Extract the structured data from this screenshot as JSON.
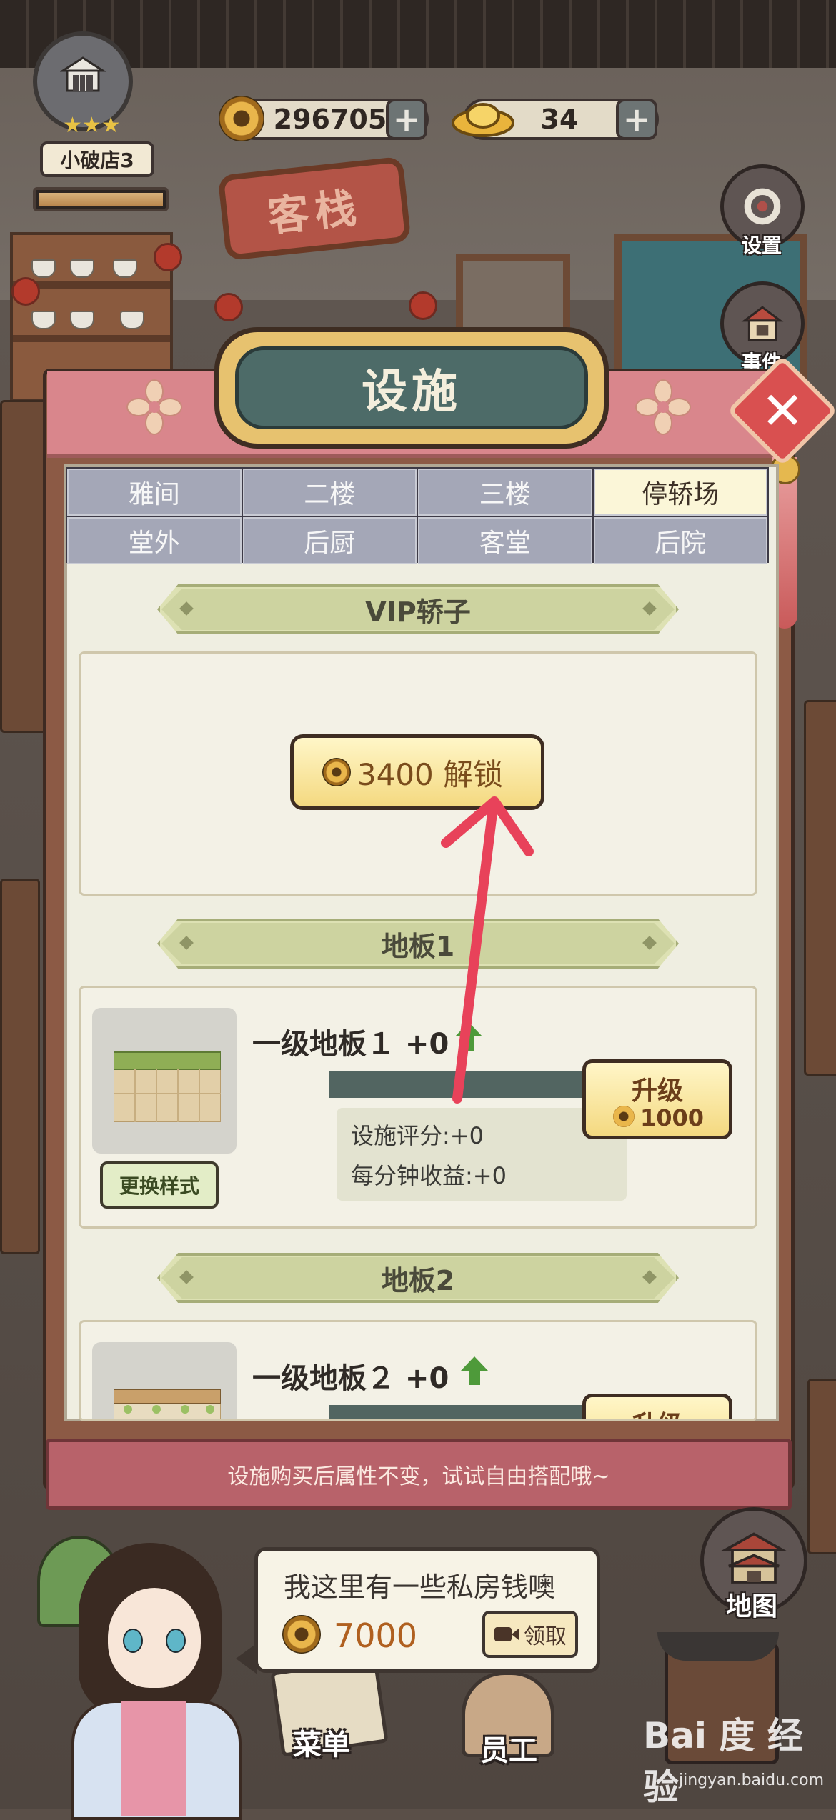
{
  "hud": {
    "shop_level_name": "小破店3",
    "coins": "296705",
    "ingots": "34",
    "plus": "+"
  },
  "side_buttons": {
    "settings": "设置",
    "events": "事件",
    "map": "地图"
  },
  "shop_sign": "客栈",
  "panel": {
    "title": "设施",
    "close": "✕",
    "tabs": [
      {
        "label": "雅间"
      },
      {
        "label": "二楼"
      },
      {
        "label": "三楼"
      },
      {
        "label": "停轿场",
        "active": true
      },
      {
        "label": "堂外"
      },
      {
        "label": "后厨"
      },
      {
        "label": "客堂"
      },
      {
        "label": "后院"
      }
    ],
    "sections": [
      {
        "title": "VIP轿子",
        "unlock_label": "3400 解锁"
      },
      {
        "title": "地板1",
        "item_name": "一级地板１ +0",
        "stat_rating": "设施评分:+0",
        "stat_income": "每分钟收益:+0",
        "upgrade_label": "升级",
        "upgrade_cost": "1000",
        "change_style_label": "更换样式"
      },
      {
        "title": "地板2",
        "item_name": "一级地板２ +0",
        "upgrade_label": "升级"
      }
    ],
    "footer_tip": "设施购买后属性不变，试试自由搭配哦~"
  },
  "bottom": {
    "speech_message": "我这里有一些私房钱噢",
    "speech_amount": "7000",
    "claim_label": "领取",
    "nav": [
      {
        "label": "菜单"
      },
      {
        "label": "员工"
      }
    ]
  },
  "watermark": {
    "brand": "Bai 度 经验",
    "url": "jingyan.baidu.com"
  },
  "colors": {
    "accent_red": "#e8425a",
    "panel_title_bg": "#4d6b68",
    "button_gold": "#f4d980",
    "tab_active": "#fbf6d8"
  },
  "icons": [
    "shop-icon",
    "coin-icon",
    "ingot-icon",
    "settings-icon",
    "events-icon",
    "close-icon",
    "up-arrow-icon",
    "video-icon",
    "map-icon"
  ]
}
